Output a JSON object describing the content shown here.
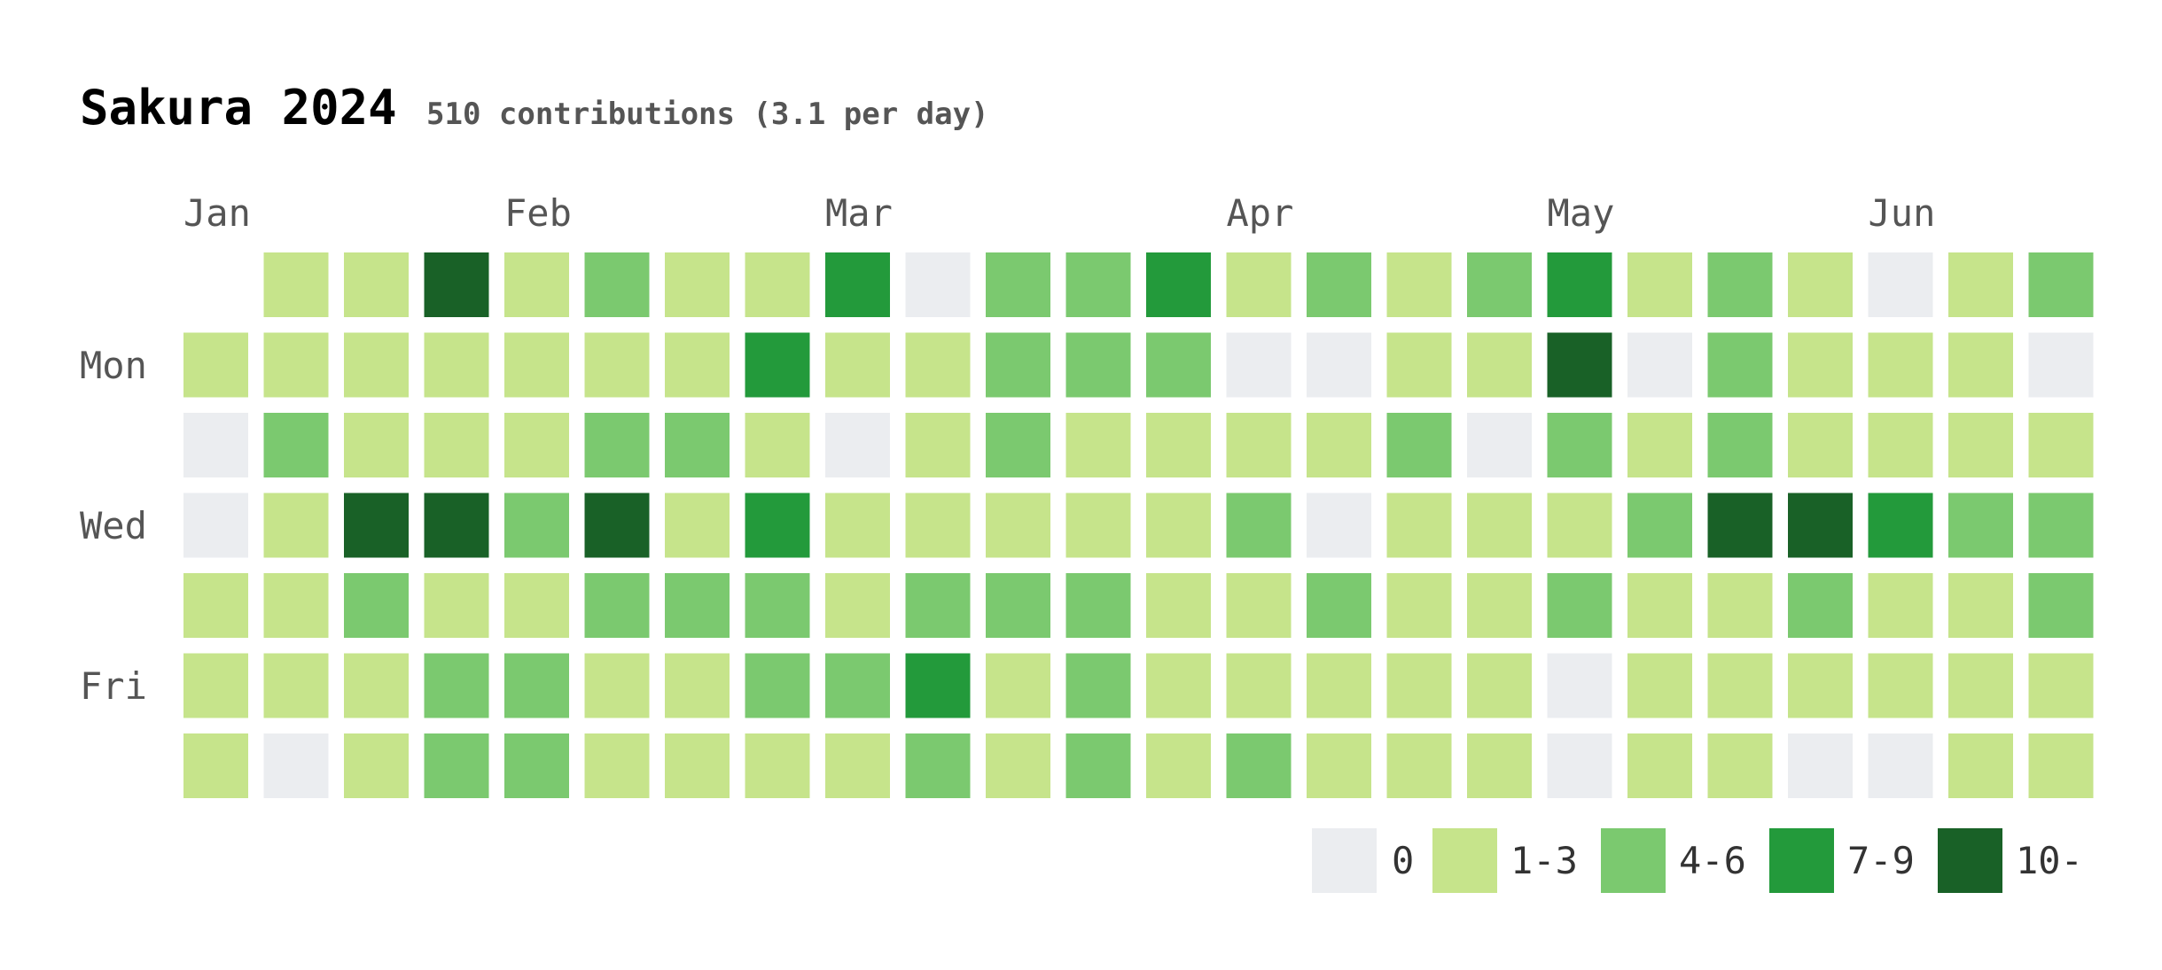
{
  "chart_data": {
    "type": "heatmap",
    "title": "Sakura 2024",
    "subtitle": "510 contributions (3.1 per day)",
    "month_labels": [
      {
        "label": "Jan",
        "week": 0
      },
      {
        "label": "Feb",
        "week": 4
      },
      {
        "label": "Mar",
        "week": 8
      },
      {
        "label": "Apr",
        "week": 13
      },
      {
        "label": "May",
        "week": 17
      },
      {
        "label": "Jun",
        "week": 21
      }
    ],
    "weekday_labels": [
      {
        "label": "Mon",
        "day": 1
      },
      {
        "label": "Wed",
        "day": 3
      },
      {
        "label": "Fri",
        "day": 5
      }
    ],
    "levels": [
      {
        "label": "0",
        "color": "#ebedf0"
      },
      {
        "label": "1-3",
        "color": "#c6e48b"
      },
      {
        "label": "4-6",
        "color": "#7bc96f"
      },
      {
        "label": "7-9",
        "color": "#239a3b"
      },
      {
        "label": "10-",
        "color": "#196127"
      }
    ],
    "grid_levels": [
      [
        null,
        1,
        1,
        4,
        1,
        2,
        1,
        1,
        3,
        0,
        2,
        2,
        3,
        1,
        2,
        1,
        2,
        3,
        1,
        2,
        1,
        0,
        1,
        2
      ],
      [
        1,
        1,
        1,
        1,
        1,
        1,
        1,
        3,
        1,
        1,
        2,
        2,
        2,
        0,
        0,
        1,
        1,
        4,
        0,
        2,
        1,
        1,
        1,
        0
      ],
      [
        0,
        2,
        1,
        1,
        1,
        2,
        2,
        1,
        0,
        1,
        2,
        1,
        1,
        1,
        1,
        2,
        0,
        2,
        1,
        2,
        1,
        1,
        1,
        1
      ],
      [
        0,
        1,
        4,
        4,
        2,
        4,
        1,
        3,
        1,
        1,
        1,
        1,
        1,
        2,
        0,
        1,
        1,
        1,
        2,
        4,
        4,
        3,
        2,
        2
      ],
      [
        1,
        1,
        2,
        1,
        1,
        2,
        2,
        2,
        1,
        2,
        2,
        2,
        1,
        1,
        2,
        1,
        1,
        2,
        1,
        1,
        2,
        1,
        1,
        2
      ],
      [
        1,
        1,
        1,
        2,
        2,
        1,
        1,
        2,
        2,
        3,
        1,
        2,
        1,
        1,
        1,
        1,
        1,
        0,
        1,
        1,
        1,
        1,
        1,
        1
      ],
      [
        1,
        0,
        1,
        2,
        2,
        1,
        1,
        1,
        1,
        2,
        1,
        2,
        1,
        2,
        1,
        1,
        1,
        0,
        1,
        1,
        0,
        0,
        1,
        1
      ]
    ]
  }
}
